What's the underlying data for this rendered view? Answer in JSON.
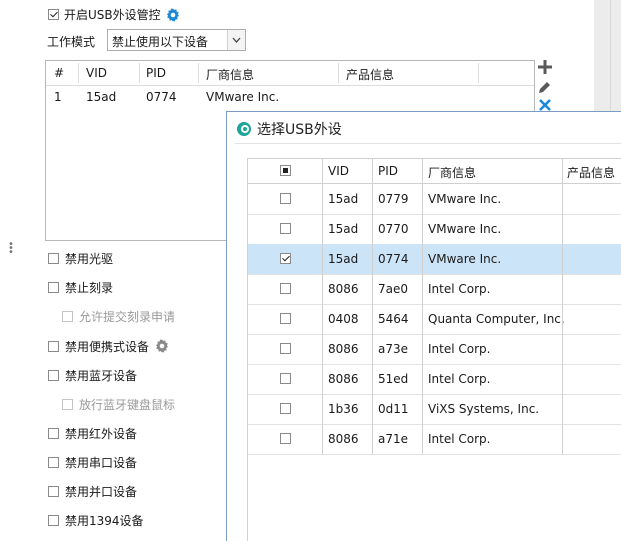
{
  "settings": {
    "enable_label": "开启USB外设管控",
    "mode_label": "工作模式",
    "mode_value": "禁止使用以下设备"
  },
  "device_list": {
    "headers": [
      "#",
      "VID",
      "PID",
      "厂商信息",
      "产品信息"
    ],
    "rows": [
      {
        "n": "1",
        "vid": "15ad",
        "pid": "0774",
        "vendor": "VMware Inc.",
        "product": ""
      }
    ]
  },
  "options": {
    "cdrom": "禁用光驱",
    "burn": "禁止刻录",
    "burn_request": "允许提交刻录申请",
    "portable": "禁用便携式设备",
    "bluetooth": "禁用蓝牙设备",
    "bt_keyboard": "放行蓝牙键盘鼠标",
    "infrared": "禁用红外设备",
    "serial": "禁用串口设备",
    "parallel": "禁用并口设备",
    "ieee1394": "禁用1394设备"
  },
  "dialog": {
    "title": "选择USB外设",
    "headers": [
      "VID",
      "PID",
      "厂商信息",
      "产品信息"
    ],
    "rows": [
      {
        "vid": "15ad",
        "pid": "0779",
        "vendor": "VMware Inc.",
        "checked": false
      },
      {
        "vid": "15ad",
        "pid": "0770",
        "vendor": "VMware Inc.",
        "checked": false
      },
      {
        "vid": "15ad",
        "pid": "0774",
        "vendor": "VMware Inc.",
        "checked": true
      },
      {
        "vid": "8086",
        "pid": "7ae0",
        "vendor": "Intel Corp.",
        "checked": false
      },
      {
        "vid": "0408",
        "pid": "5464",
        "vendor": "Quanta Computer, Inc.",
        "checked": false
      },
      {
        "vid": "8086",
        "pid": "a73e",
        "vendor": "Intel Corp.",
        "checked": false
      },
      {
        "vid": "8086",
        "pid": "51ed",
        "vendor": "Intel Corp.",
        "checked": false
      },
      {
        "vid": "1b36",
        "pid": "0d11",
        "vendor": "ViXS Systems, Inc.",
        "checked": false
      },
      {
        "vid": "8086",
        "pid": "a71e",
        "vendor": "Intel Corp.",
        "checked": false
      }
    ]
  },
  "colors": {
    "accent": "#1e88d8",
    "selected_row": "#cce4f7",
    "dialog_icon": "#1fa59b"
  },
  "icons": [
    "gear-icon",
    "plus-icon",
    "pencil-icon",
    "close-icon",
    "dropdown-arrow-icon",
    "select-device-icon"
  ]
}
